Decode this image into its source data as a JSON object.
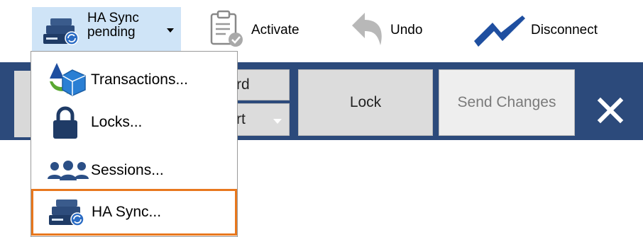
{
  "toolbar": {
    "ha_sync": {
      "label_line1": "HA Sync",
      "label_line2": "pending"
    },
    "activate_label": "Activate",
    "undo_label": "Undo",
    "disconnect_label": "Disconnect"
  },
  "actionbar": {
    "partial_top_label": "rd",
    "partial_bottom_label": "rt",
    "lock_label": "Lock",
    "send_changes_label": "Send Changes",
    "close_symbol": "✕"
  },
  "menu": {
    "items": [
      {
        "label": "Transactions...",
        "icon": "transactions-icon"
      },
      {
        "label": "Locks...",
        "icon": "lock-icon"
      },
      {
        "label": "Sessions...",
        "icon": "sessions-icon"
      },
      {
        "label": "HA Sync...",
        "icon": "ha-sync-icon"
      }
    ]
  },
  "colors": {
    "accent_blue_bar": "#2c4a7b",
    "selected_toolbar": "#cfe4f7",
    "highlight_border": "#e8781e",
    "disconnect_icon": "#1f4fa0"
  }
}
